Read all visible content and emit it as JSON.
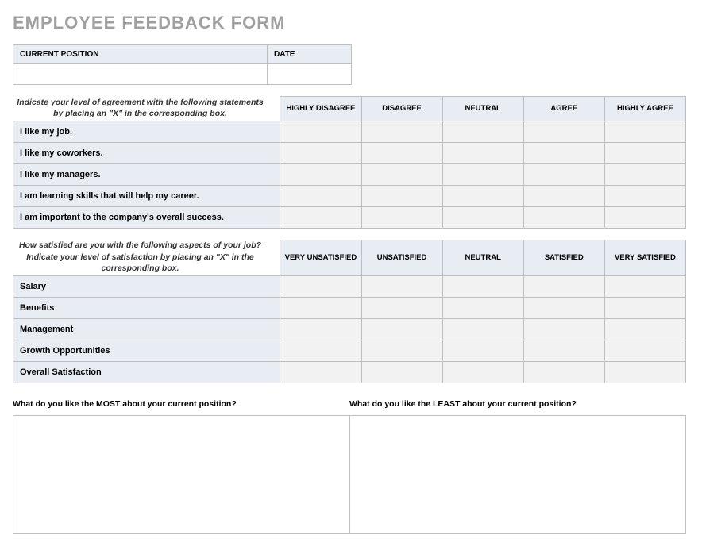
{
  "title": "EMPLOYEE FEEDBACK FORM",
  "info": {
    "position_label": "CURRENT POSITION",
    "position_value": "",
    "date_label": "DATE",
    "date_value": ""
  },
  "agreement": {
    "instructions": "Indicate your level of agreement with the following statements by placing an \"X\" in the corresponding box.",
    "columns": [
      "HIGHLY DISAGREE",
      "DISAGREE",
      "NEUTRAL",
      "AGREE",
      "HIGHLY AGREE"
    ],
    "rows": [
      "I like my job.",
      "I like my coworkers.",
      "I like my managers.",
      "I am learning skills that will help my career.",
      "I am important to the company's overall success."
    ]
  },
  "satisfaction": {
    "instructions": "How satisfied are you with the following aspects of your job? Indicate your level of satisfaction by placing an \"X\" in the corresponding box.",
    "columns": [
      "VERY UNSATISFIED",
      "UNSATISFIED",
      "NEUTRAL",
      "SATISFIED",
      "VERY SATISFIED"
    ],
    "rows": [
      "Salary",
      "Benefits",
      "Management",
      "Growth Opportunities",
      "Overall Satisfaction"
    ]
  },
  "open": {
    "most_q": "What do you like the MOST about your current position?",
    "most_v": "",
    "least_q": "What do you like the LEAST about your current position?",
    "least_v": ""
  }
}
